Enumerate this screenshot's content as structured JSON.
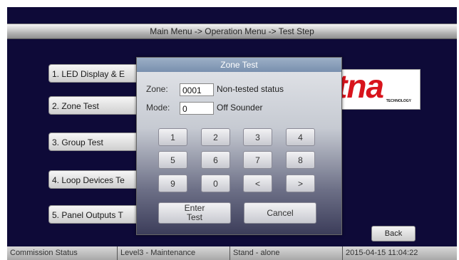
{
  "title_bar": {
    "breadcrumb": "Main Menu -> Operation Menu -> Test Step"
  },
  "menu": {
    "items": [
      {
        "label": "1. LED Display & E"
      },
      {
        "label": "2. Zone Test"
      },
      {
        "label": "3. Group Test"
      },
      {
        "label": "4. Loop Devices Te"
      },
      {
        "label": "5. Panel Outputs T"
      }
    ]
  },
  "logo": {
    "brand": "tna",
    "tagline": "TECHNOLOGY"
  },
  "dialog": {
    "title": "Zone Test",
    "zone_label": "Zone:",
    "zone_value": "0001",
    "zone_status": "Non-tested status",
    "mode_label": "Mode:",
    "mode_value": "0",
    "mode_status": "Off Sounder",
    "keys": [
      "1",
      "2",
      "3",
      "4",
      "5",
      "6",
      "7",
      "8",
      "9",
      "0",
      "<",
      ">"
    ],
    "enter_line1": "Enter",
    "enter_line2": "Test",
    "cancel_label": "Cancel"
  },
  "back_label": "Back",
  "status_bar": {
    "commission": "Commission Status",
    "level": "Level3 - Maintenance",
    "mode": "Stand - alone",
    "datetime": "2015-04-15 11:04:22"
  },
  "colors": {
    "screen_bg": "#0e0a38",
    "dialog_title": "#7990ae",
    "logo_red": "#d8141c"
  }
}
